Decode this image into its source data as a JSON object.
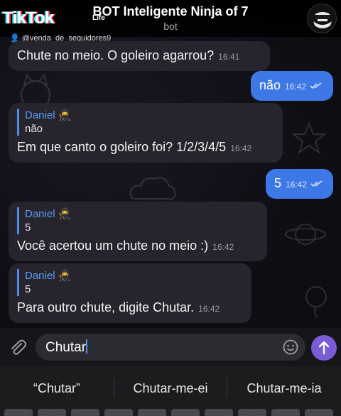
{
  "header": {
    "bot_name": "BOT Inteligente Ninja of 7",
    "status": "bot",
    "avatar_icon": "ninja-avatar-icon"
  },
  "watermark": {
    "logo": "TikTok",
    "life": "Life",
    "username": "@venda_de_seguidores9"
  },
  "messages": [
    {
      "side": "in",
      "text": "Chute no meio. O goleiro agarrou?",
      "time": "16:41"
    },
    {
      "side": "out",
      "text": "não",
      "time": "16:42",
      "status": "read"
    },
    {
      "side": "in",
      "reply_name": "Daniel",
      "reply_text": "não",
      "text": "Em que canto o goleiro foi? 1/2/3/4/5",
      "time": "16:42"
    },
    {
      "side": "out",
      "text": "5",
      "time": "16:42",
      "status": "read"
    },
    {
      "side": "in",
      "reply_name": "Daniel",
      "reply_text": "5",
      "text": "Você acertou um chute no meio :)",
      "time": "16:42"
    },
    {
      "side": "in",
      "reply_name": "Daniel",
      "reply_text": "5",
      "text": "Para outro chute, digite Chutar.",
      "time": "16:42"
    }
  ],
  "composer": {
    "value": "Chutar",
    "attach_icon": "paperclip-icon",
    "emoji_icon": "emoji-icon",
    "send_icon": "send-arrow-icon"
  },
  "keyboard": {
    "suggestions": [
      "“Chutar”",
      "Chutar-me-ei",
      "Chutar-me-ia"
    ]
  },
  "colors": {
    "incoming_bubble": "#27242e",
    "outgoing_bubble": "#3e78e6",
    "reply_accent": "#5b9df5",
    "send_button": "#7b5cd6"
  }
}
